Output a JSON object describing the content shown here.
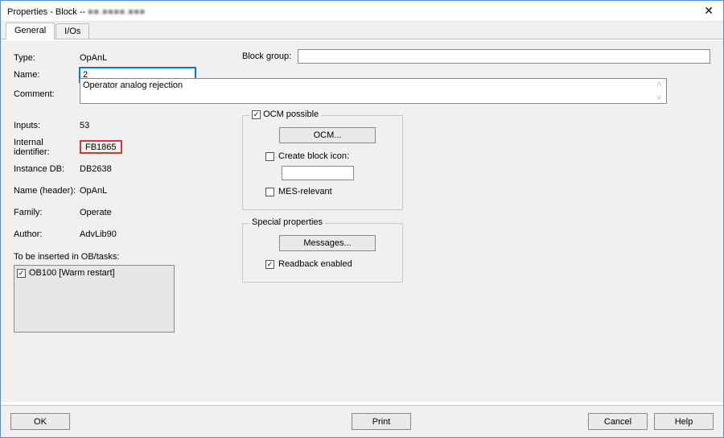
{
  "title_prefix": "Properties - Block -- ",
  "title_blur": "■■.■■■■.■■■",
  "tabs": {
    "general": "General",
    "ios": "I/Os"
  },
  "labels": {
    "type": "Type:",
    "name": "Name:",
    "comment": "Comment:",
    "inputs": "Inputs:",
    "internal_id": "Internal identifier:",
    "instance_db": "Instance DB:",
    "name_header": "Name (header):",
    "family": "Family:",
    "author": "Author:",
    "ob_group": "To be inserted in OB/tasks:",
    "block_group": "Block group:",
    "ocm_possible": "OCM possible",
    "create_block_icon": "Create block icon:",
    "mes_relevant": "MES-relevant",
    "special_props": "Special properties",
    "readback": "Readback enabled"
  },
  "values": {
    "type": "OpAnL",
    "name": "2",
    "comment": "Operator analog rejection",
    "inputs": "53",
    "internal_id": "FB1865",
    "instance_db": "DB2638",
    "name_header": "OpAnL",
    "family": "Operate",
    "author": "AdvLib90",
    "ob_item": "OB100 [Warm restart]"
  },
  "buttons": {
    "ocm": "OCM...",
    "messages": "Messages...",
    "ok": "OK",
    "print": "Print",
    "cancel": "Cancel",
    "help": "Help"
  }
}
